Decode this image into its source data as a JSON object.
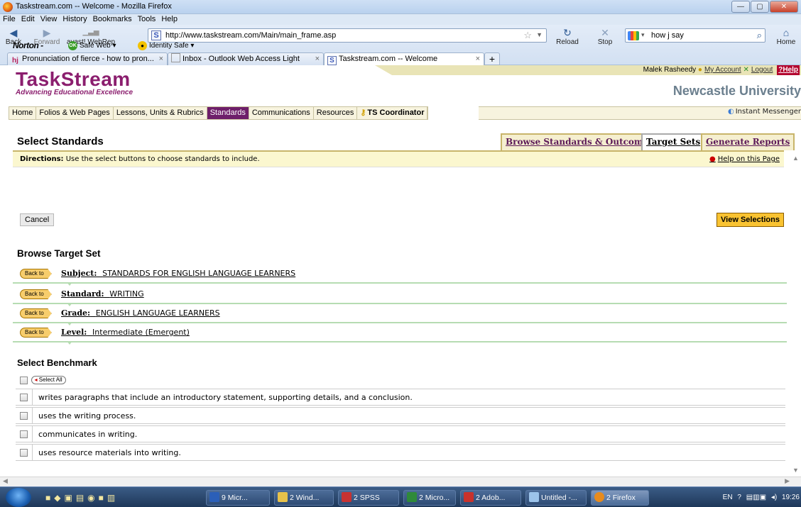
{
  "window": {
    "title": "Taskstream.com -- Welcome - Mozilla Firefox",
    "min": "—",
    "max": "▢",
    "close": "✕"
  },
  "menu": [
    "File",
    "Edit",
    "View",
    "History",
    "Bookmarks",
    "Tools",
    "Help"
  ],
  "nav": {
    "back": "Back",
    "forward": "Forward",
    "avast": "avast! WebRep",
    "url": "http://www.taskstream.com/Main/main_frame.asp",
    "reload": "Reload",
    "stop": "Stop",
    "search": "how j say",
    "home": "Home"
  },
  "norton": {
    "brand": "Norton -",
    "safe_web": "Safe Web ▾",
    "identity_safe": "Identity Safe ▾"
  },
  "tabs": [
    {
      "label": "Pronunciation of fierce - how to pron..."
    },
    {
      "label": "Inbox - Outlook Web Access Light"
    },
    {
      "label": "Taskstream.com -- Welcome"
    }
  ],
  "user": {
    "name": "Malek Rasheedy",
    "account": "My Account",
    "logout": "Logout",
    "help": "Help"
  },
  "brand": {
    "name": "TaskStream",
    "tagline": "Advancing Educational Excellence",
    "university": "Newcastle University"
  },
  "navtabs": [
    "Home",
    "Folios & Web Pages",
    "Lessons, Units & Rubrics",
    "Standards",
    "Communications",
    "Resources",
    "TS Coordinator"
  ],
  "instant_messenger": "Instant Messenger",
  "page": {
    "title": "Select Standards",
    "tabs": [
      "Browse Standards & Outcomes",
      "Target Sets",
      "Generate Reports"
    ],
    "directions_label": "Directions:",
    "directions": "Use the select buttons to choose standards to include.",
    "help_page": "Help on this Page",
    "cancel": "Cancel",
    "view_selections": "View Selections",
    "browse_heading": "Browse Target Set",
    "back_to": "Back to",
    "breadcrumbs": [
      {
        "label": "Subject:",
        "value": "STANDARDS FOR ENGLISH LANGUAGE LEARNERS"
      },
      {
        "label": "Standard:",
        "value": "WRITING"
      },
      {
        "label": "Grade:",
        "value": "ENGLISH LANGUAGE LEARNERS"
      },
      {
        "label": "Level:",
        "value": "Intermediate (Emergent)"
      }
    ],
    "benchmark_heading": "Select Benchmark",
    "select_all": "Select All",
    "benchmarks": [
      "writes paragraphs that include an introductory statement, supporting details, and a conclusion.",
      "uses the writing process.",
      "communicates in writing.",
      "uses resource materials into writing."
    ]
  },
  "taskbar": {
    "items": [
      "9 Micr...",
      "2 Wind...",
      "2 SPSS",
      "2 Micro...",
      "2 Adob...",
      "Untitled -...",
      "2 Firefox"
    ],
    "lang": "EN",
    "time": "19:26"
  }
}
